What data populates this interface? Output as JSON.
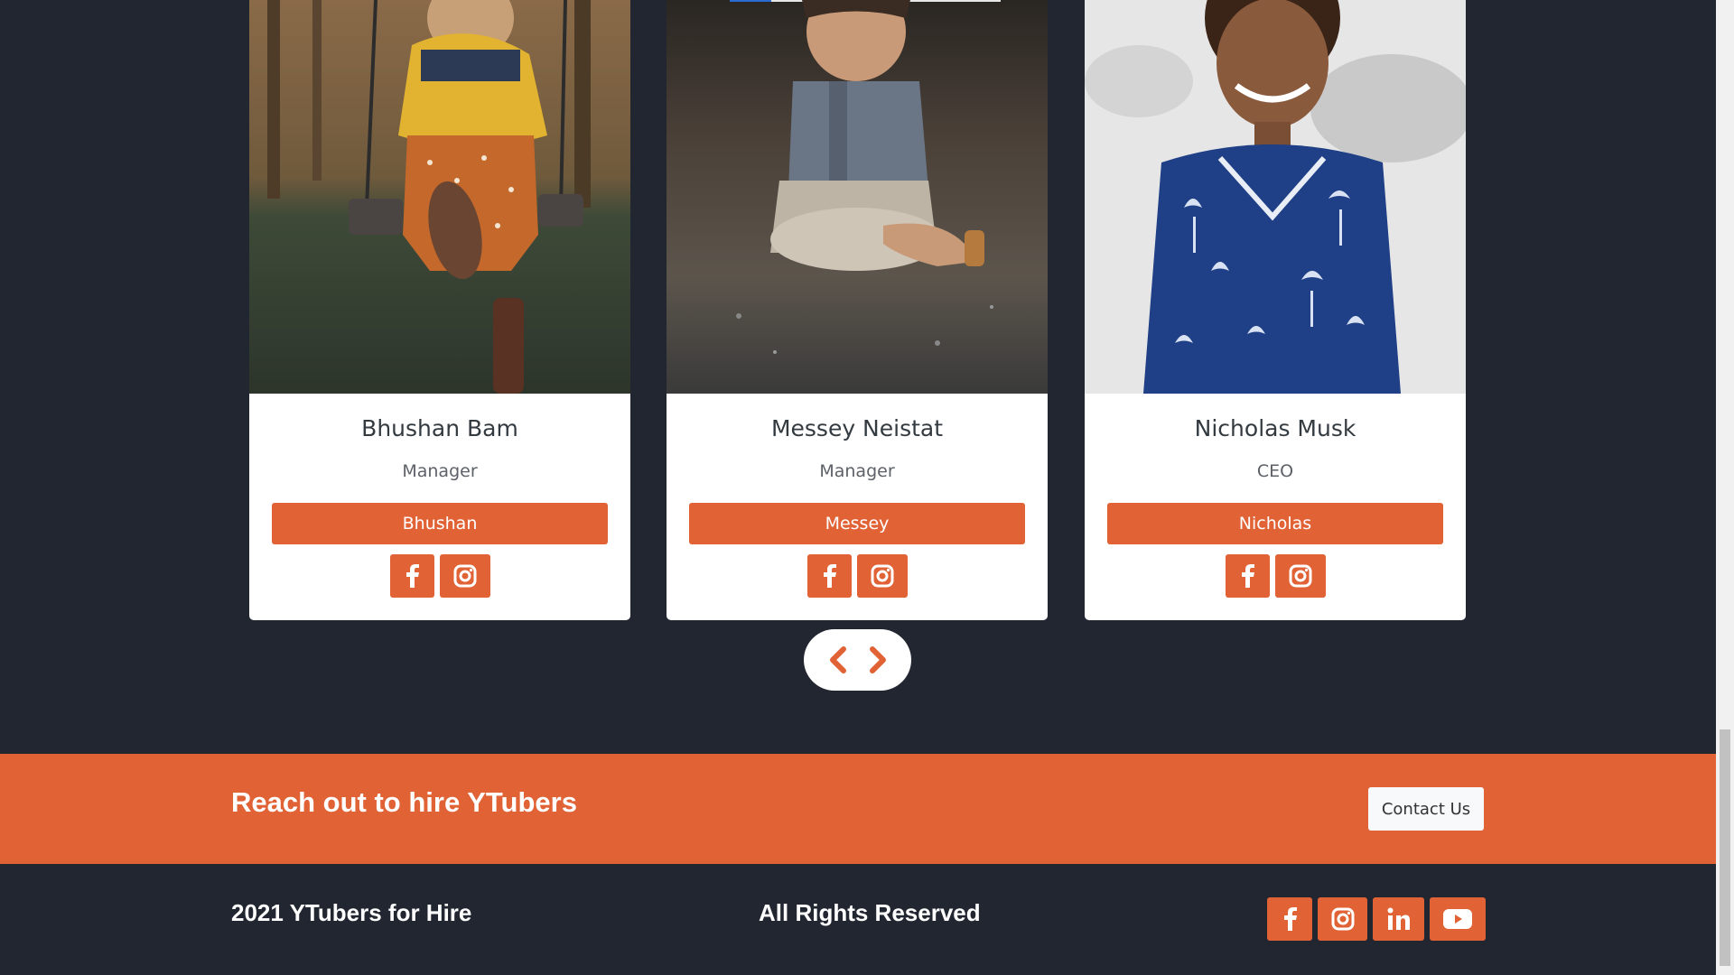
{
  "team": {
    "cards": [
      {
        "name": "Bhushan Bam",
        "role": "Manager",
        "button_label": "Bhushan",
        "icons": [
          "facebook-icon",
          "instagram-icon"
        ]
      },
      {
        "name": "Messey Neistat",
        "role": "Manager",
        "button_label": "Messey",
        "icons": [
          "facebook-icon",
          "instagram-icon"
        ]
      },
      {
        "name": "Nicholas Musk",
        "role": "CEO",
        "button_label": "Nicholas",
        "icons": [
          "facebook-icon",
          "instagram-icon"
        ]
      }
    ],
    "pager": {
      "prev_icon": "chevron-left-icon",
      "next_icon": "chevron-right-icon"
    }
  },
  "cta": {
    "text": "Reach out to hire YTubers",
    "button_label": "Contact Us"
  },
  "footer": {
    "copyright": "2021 YTubers for Hire",
    "rights": "All Rights Reserved",
    "social_icons": [
      "facebook-icon",
      "instagram-icon",
      "linkedin-icon",
      "youtube-icon"
    ]
  },
  "colors": {
    "accent": "#e06235",
    "background": "#222630",
    "card": "#ffffff",
    "contact_button": "#f8f9fa"
  }
}
